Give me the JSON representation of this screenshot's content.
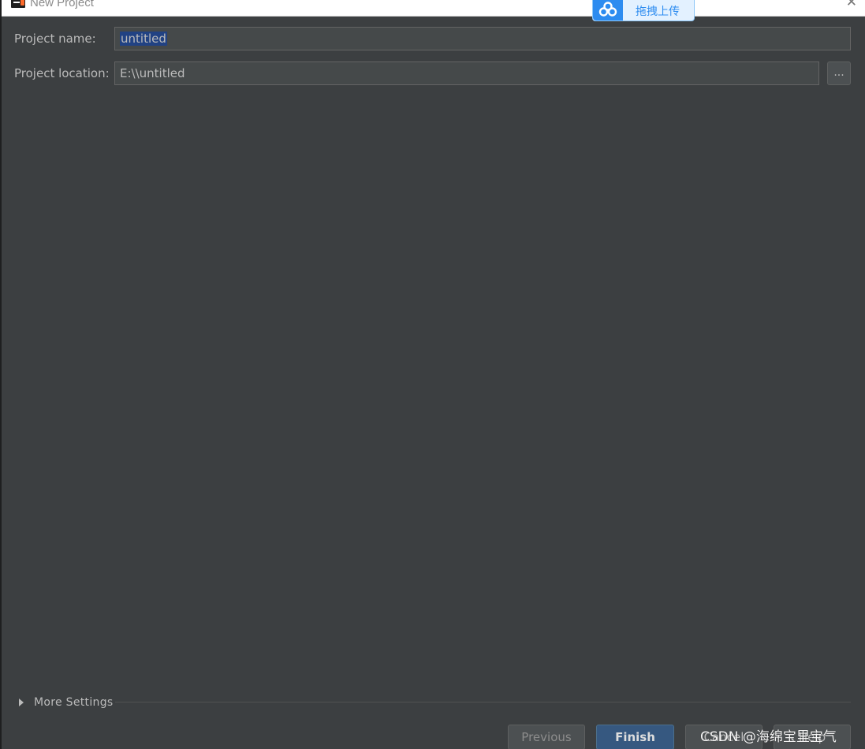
{
  "window": {
    "title": "New Project",
    "close_glyph": "✕"
  },
  "upload_widget": {
    "label": "拖拽上传",
    "icon": "cloud-upload-icon"
  },
  "form": {
    "project_name": {
      "label": "Project name:",
      "value": "untitled"
    },
    "project_location": {
      "label": "Project location:",
      "value": "E:\\\\untitled"
    },
    "browse_label": "..."
  },
  "more_settings": {
    "label": "More Settings"
  },
  "buttons": {
    "previous": "Previous",
    "finish": "Finish",
    "cancel": "Cancel",
    "help": "Help"
  },
  "watermark": "CSDN @海绵宝里宝气",
  "colors": {
    "background": "#3c3f41",
    "field_bg": "#45494a",
    "selection": "#214283",
    "primary_button": "#365880"
  }
}
